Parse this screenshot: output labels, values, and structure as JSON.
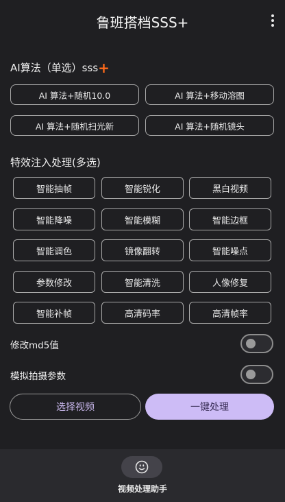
{
  "appbar": {
    "title": "鲁班搭档SSS+"
  },
  "ai_section": {
    "title": "AI算法（单选）sss",
    "plus_symbol": "+",
    "options": [
      "AI 算法+随机10.0",
      "AI 算法+移动溶图",
      "AI 算法+随机扫光新",
      "AI 算法+随机镜头"
    ]
  },
  "effects_section": {
    "title": "特效注入处理(多选)",
    "options": [
      "智能抽帧",
      "智能锐化",
      "黑白视频",
      "智能降噪",
      "智能模糊",
      "智能边框",
      "智能调色",
      "镜像翻转",
      "智能噪点",
      "参数修改",
      "智能清洗",
      "人像修复",
      "智能补帧",
      "高清码率",
      "高清帧率"
    ]
  },
  "toggles": [
    {
      "label": "修改md5值",
      "on": false
    },
    {
      "label": "模拟拍摄参数",
      "on": false
    }
  ],
  "actions": {
    "select_video": "选择视频",
    "one_click": "一键处理"
  },
  "bottom_nav": {
    "label": "视频处理助手",
    "icon": "face-icon"
  }
}
